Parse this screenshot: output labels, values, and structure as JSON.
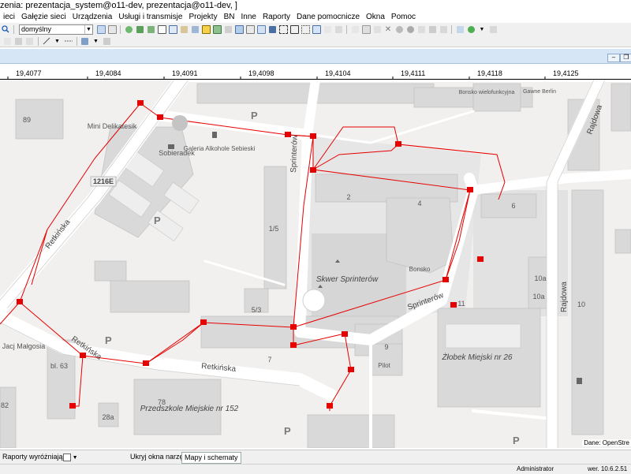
{
  "window": {
    "title": "zenia: prezentacja_system@o11-dev, prezentacja@o11-dev, ]"
  },
  "menu": [
    "ieci",
    "Gałęzie sieci",
    "Urządzenia",
    "Usługi i transmisje",
    "Projekty",
    "BN",
    "Inne",
    "Raporty",
    "Dane pomocnicze",
    "Okna",
    "Pomoc"
  ],
  "toolbar": {
    "style_combo_value": "domyślny"
  },
  "ruler": {
    "labels": [
      "19,4077",
      "19,4084",
      "19,4091",
      "19,4098",
      "19,4104",
      "19,4111",
      "19,4118",
      "19,4125"
    ]
  },
  "map": {
    "street_labels": [
      "Retkińska",
      "Retkińska",
      "Retkińska",
      "Sprinterów",
      "Sprinterów",
      "Rajdowa",
      "Rajdowa"
    ],
    "place_labels": [
      "Skwer Sprinterów",
      "Żłobek Miejski nr 26",
      "Przedszkole Miejskie nr 152",
      "Mini Delikatesik",
      "Sobieradek",
      "Galeria Alkohole Sebieski",
      "Bonsko",
      "Pilot",
      "Jacj Małgosia",
      "Gawne Berlin",
      "Bonsko wielofunkcyjna"
    ],
    "building_numbers": [
      "89",
      "1/5",
      "2",
      "4",
      "6",
      "5/3",
      "7",
      "9",
      "10",
      "10a",
      "10a",
      "11",
      "78",
      "28a",
      "bl. 63",
      "82",
      "P"
    ],
    "road_badge": "1216E",
    "attribution": "Dane: OpenStre"
  },
  "bottom": {
    "reports_button": "Raporty wyróżniające",
    "hide_tools": "Ukryj okna narzędzi",
    "maps_tab": "Mapy i schematy"
  },
  "status": {
    "user": "Administrator",
    "version": "wer. 10.6.2.51"
  },
  "colors": {
    "network_line": "#e60000",
    "building": "#d9d9d9",
    "road": "#ffffff",
    "park": "#d8d8d8",
    "header": "#d7e6f7"
  }
}
